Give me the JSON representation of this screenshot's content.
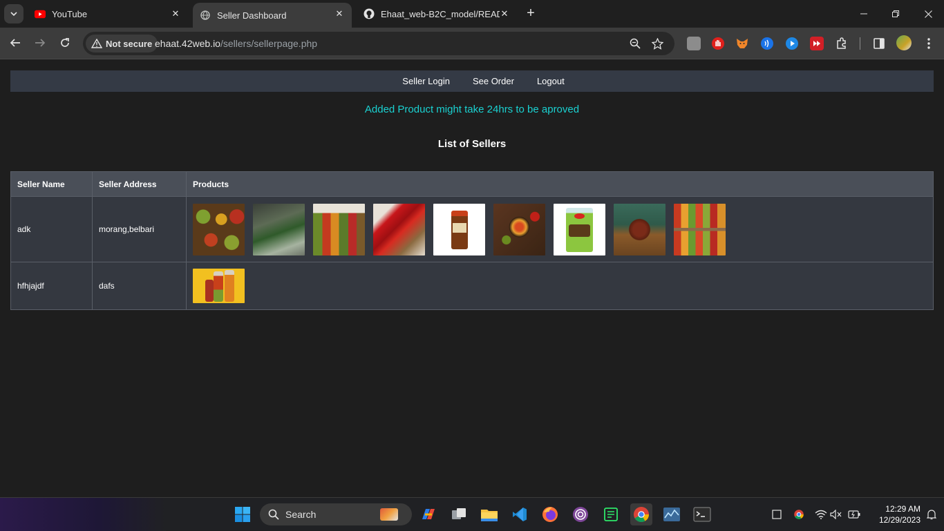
{
  "browser": {
    "tabs": [
      {
        "title": "YouTube",
        "active": false
      },
      {
        "title": "Seller Dashboard",
        "active": true
      },
      {
        "title": "Ehaat_web-B2C_model/READM",
        "active": false
      }
    ],
    "security_label": "Not secure",
    "url_host": "ehaat.42web.io",
    "url_path": "/sellers/sellerpage.php"
  },
  "nav": {
    "items": [
      "Seller Login",
      "See Order",
      "Logout"
    ]
  },
  "notice": "Added Product might take 24hrs to be aproved",
  "heading": "List of Sellers",
  "table": {
    "headers": [
      "Seller Name",
      "Seller Address",
      "Products"
    ],
    "rows": [
      {
        "name": "adk",
        "address": "morang,belbari",
        "product_count": 9
      },
      {
        "name": "hfhjajdf",
        "address": "dafs",
        "product_count": 1
      }
    ]
  },
  "taskbar": {
    "search_label": "Search",
    "time": "12:29 AM",
    "date": "12/29/2023"
  },
  "colors": {
    "notice": "#1ad1d1",
    "navbar_bg": "#343a45",
    "table_header_bg": "#4a4f58",
    "page_bg": "#1e1e1e"
  }
}
